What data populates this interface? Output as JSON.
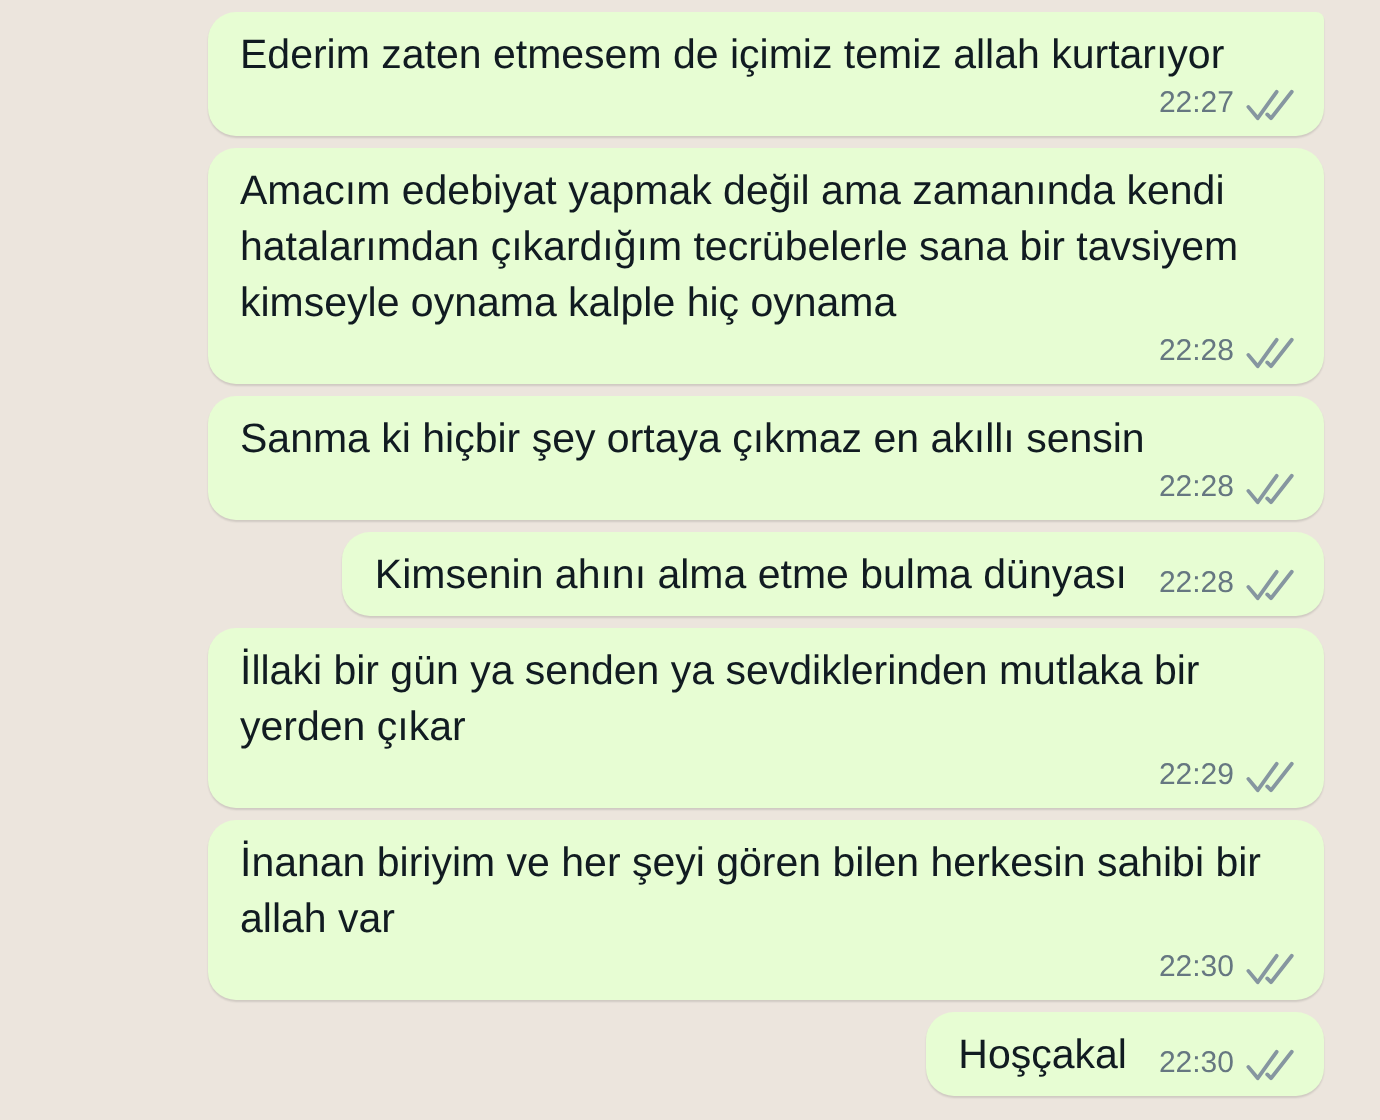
{
  "messages": [
    {
      "text": "Ederim zaten etmesem de içimiz temiz allah kurtarıyor",
      "time": "22:27",
      "read": false
    },
    {
      "text": "Amacım edebiyat yapmak değil ama zamanında kendi hatalarımdan çıkardığım tecrübelerle sana bir tavsiyem kimseyle oynama kalple hiç oynama",
      "time": "22:28",
      "read": false
    },
    {
      "text": "Sanma ki hiçbir şey ortaya çıkmaz en akıllı sensin",
      "time": "22:28",
      "read": false
    },
    {
      "text": "Kimsenin ahını alma etme bulma dünyası",
      "time": "22:28",
      "read": false
    },
    {
      "text": "İllaki bir gün ya senden ya sevdiklerinden mutlaka bir yerden çıkar",
      "time": "22:29",
      "read": false
    },
    {
      "text": "İnanan biriyim ve her şeyi gören bilen herkesin sahibi bir allah var",
      "time": "22:30",
      "read": false
    },
    {
      "text": "Hoşçakal",
      "time": "22:30",
      "read": false
    }
  ]
}
